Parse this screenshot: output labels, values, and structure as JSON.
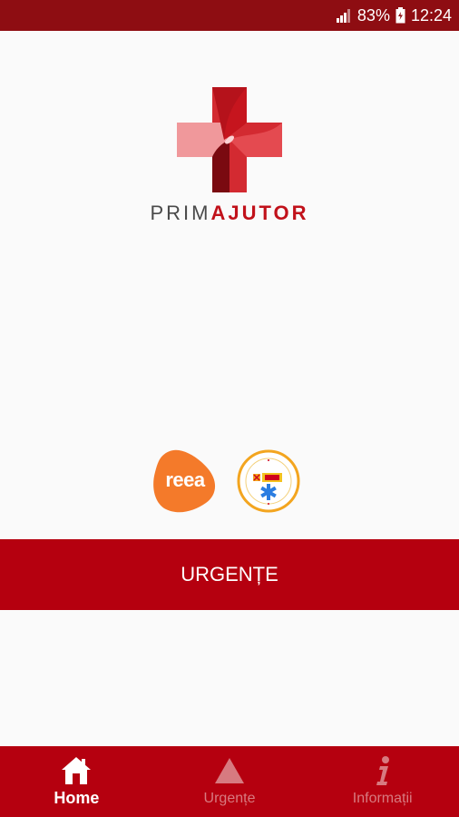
{
  "status_bar": {
    "battery": "83%",
    "time": "12:24"
  },
  "logo": {
    "light": "PRIM",
    "bold": "AJUTOR"
  },
  "partners": {
    "reea": "reea"
  },
  "main": {
    "urgente_label": "URGENȚE"
  },
  "bottom_nav": {
    "items": [
      {
        "label": "Home",
        "icon": "home-icon",
        "active": true
      },
      {
        "label": "Urgențe",
        "icon": "warning-triangle-icon",
        "active": false
      },
      {
        "label": "Informații",
        "icon": "info-icon",
        "active": false
      }
    ]
  },
  "colors": {
    "brand_red": "#b5000f",
    "status_bar": "#8e0d12",
    "inactive_label": "#d77a80",
    "reea_orange": "#f47a2a"
  }
}
